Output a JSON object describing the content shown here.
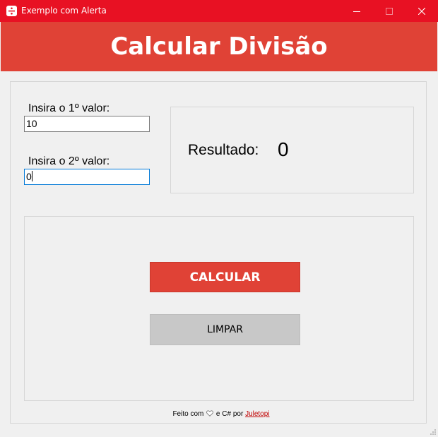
{
  "window": {
    "title": "Exemplo com Alerta",
    "accent": "#e81123",
    "controls": {
      "minimize": "minimize-icon",
      "maximize": "maximize-icon",
      "close": "close-icon"
    }
  },
  "header": {
    "title": "Calcular Divisão",
    "background": "#e04236"
  },
  "form": {
    "first_label": "Insira o 1º valor:",
    "first_value": "10",
    "second_label": "Insira o 2º valor:",
    "second_value": "0"
  },
  "result": {
    "label": "Resultado:",
    "value": "0"
  },
  "buttons": {
    "calculate": "CALCULAR",
    "clear": "LIMPAR"
  },
  "footer": {
    "prefix": "Feito com",
    "heart_icon": "heart-icon",
    "middle": "e C# por",
    "link_text": "Juletopi"
  }
}
